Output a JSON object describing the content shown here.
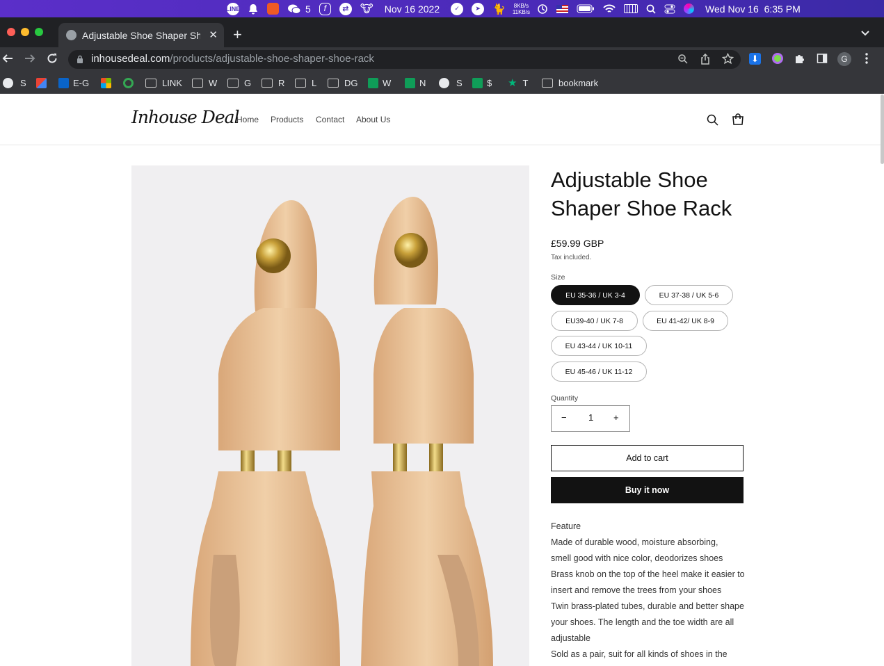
{
  "menubar": {
    "wechat_count": "5",
    "date_short": "Nov 16 2022",
    "net_up": "8KB/s",
    "net_down": "11KB/s",
    "clock": "Wed Nov 16  6:35 PM"
  },
  "browser": {
    "tab_title": "Adjustable Shoe Shaper Shoe R",
    "url_host": "inhousedeal.com",
    "url_path": "/products/adjustable-shoe-shaper-shoe-rack",
    "profile_initial": "G",
    "bookmarks": [
      "S",
      "E-G",
      "LINK",
      "W",
      "G",
      "R",
      "L",
      "DG",
      "W",
      "N",
      "S",
      "$",
      "T",
      "bookmark"
    ]
  },
  "store": {
    "logo": "Inhouse Deal",
    "nav": [
      "Home",
      "Products",
      "Contact",
      "About Us"
    ]
  },
  "product": {
    "title": "Adjustable Shoe Shaper Shoe Rack",
    "price": "£59.99 GBP",
    "tax_note": "Tax included.",
    "size_label": "Size",
    "sizes": [
      "EU 35-36 / UK 3-4",
      "EU 37-38 / UK 5-6",
      "EU39-40 / UK 7-8",
      "EU 41-42/ UK 8-9",
      "EU 43-44 / UK 10-11",
      "EU 45-46 / UK 11-12"
    ],
    "selected_size": "EU 35-36 / UK 3-4",
    "quantity_label": "Quantity",
    "quantity": "1",
    "qty_minus": "−",
    "qty_plus": "+",
    "add_to_cart": "Add to cart",
    "buy_now": "Buy it now",
    "description": [
      "Feature",
      "Made of durable wood, moisture absorbing, smell good with nice color, deodorizes shoes",
      "Brass knob on the top of the heel make it easier to insert and remove the trees from your shoes",
      "Twin brass-plated tubes, durable and better shape your shoes. The length and the toe width are all adjustable",
      "Sold as a pair, suit for all kinds of shoes in the"
    ]
  }
}
